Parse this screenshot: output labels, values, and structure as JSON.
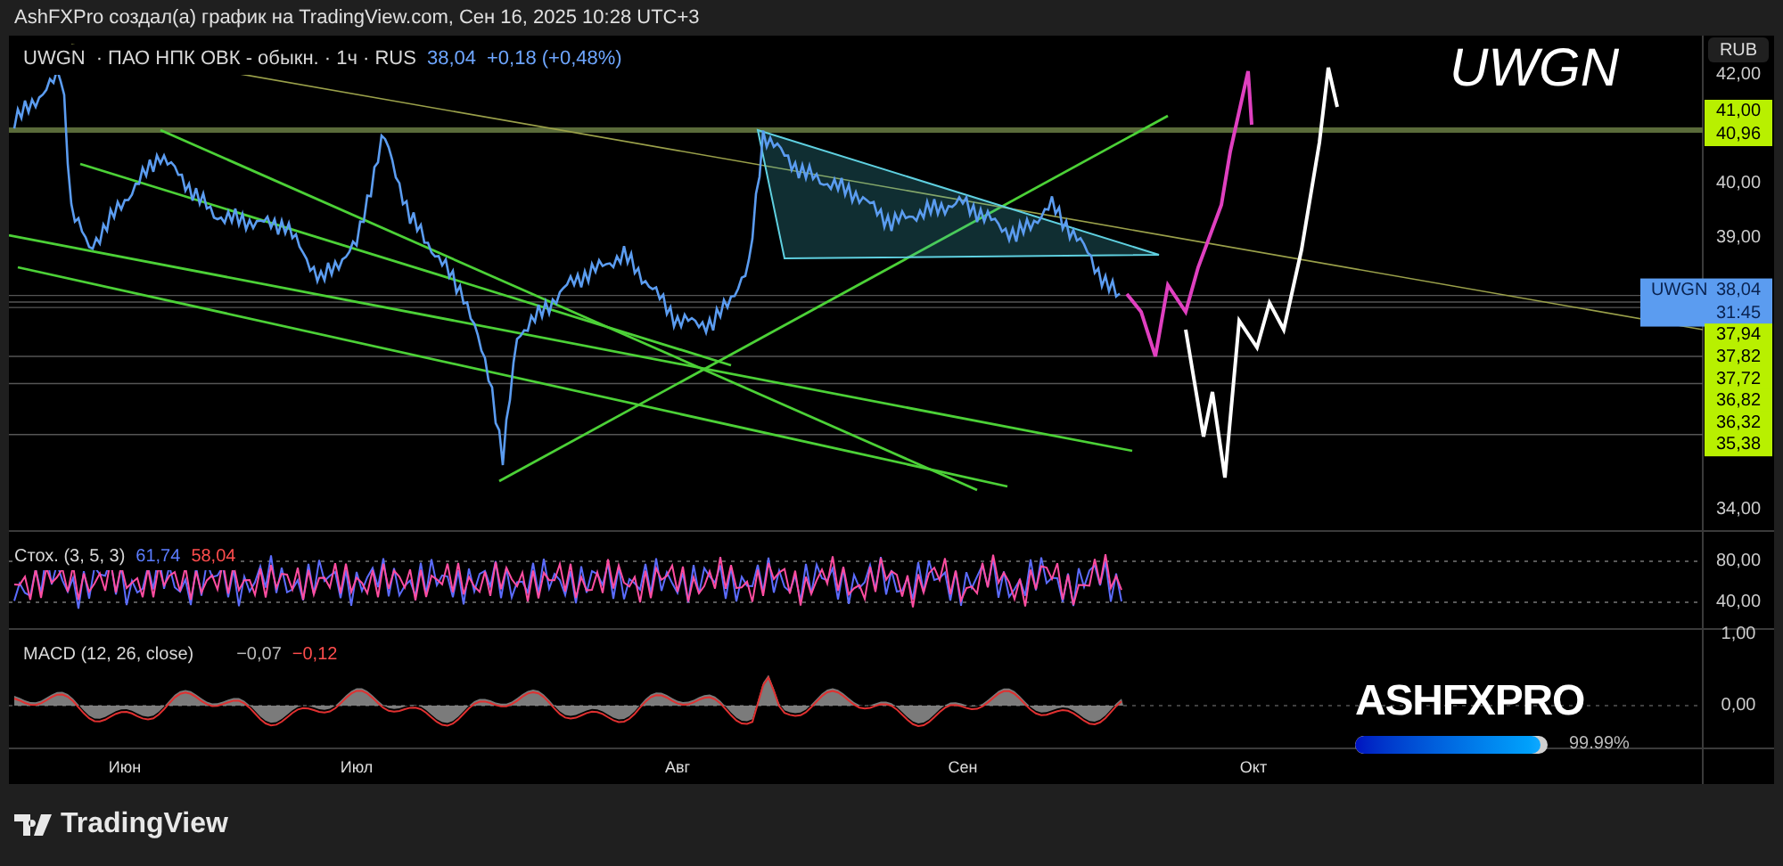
{
  "header": {
    "text": "AshFXPro создал(а) график на TradingView.com, Сен 16, 2025 10:28 UTC+3"
  },
  "legend": {
    "symbol": "UWGN",
    "description": "· ПАО НПК ОВК - обыкн. · 1ч · RUS",
    "price": "38,04",
    "change": "+0,18 (+0,48%)"
  },
  "chart_title": "UWGN",
  "price_scale": {
    "currency": "RUB",
    "ticks": [
      "42,00",
      "40,00",
      "39,00",
      "34,00"
    ],
    "levels": [
      {
        "text": "41,00"
      },
      {
        "text": "40,96"
      }
    ],
    "last": {
      "symbol": "UWGN",
      "price": "38,04",
      "countdown": "31:45"
    },
    "lower_levels": [
      {
        "text": "37,94"
      },
      {
        "text": "37,82"
      },
      {
        "text": "37,72"
      },
      {
        "text": "36,82"
      },
      {
        "text": "36,32"
      },
      {
        "text": "35,38"
      }
    ]
  },
  "stochastic": {
    "legend": "Стох. (3, 5, 3)",
    "k": "61,74",
    "d": "58,04",
    "ticks": [
      "80,00",
      "40,00"
    ]
  },
  "macd": {
    "legend": "MACD (12, 26, close)",
    "macd": "−0,07",
    "signal": "−0,12",
    "ticks": [
      "1,00",
      "0,00"
    ]
  },
  "time_axis": [
    "Июн",
    "Июл",
    "Авг",
    "Сен",
    "Окт"
  ],
  "branding": {
    "name": "ASHFXPRO",
    "level": 0.96,
    "reading": "99.99%"
  },
  "footer": {
    "logo": "TradingView"
  }
}
